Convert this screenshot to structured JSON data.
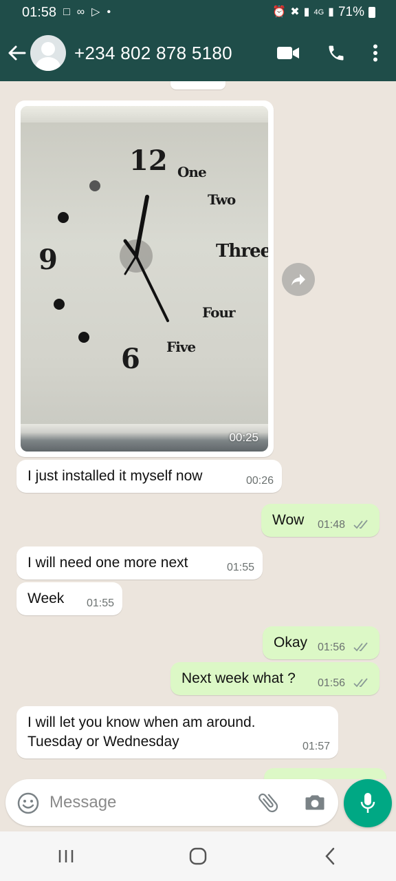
{
  "status_bar": {
    "time": "01:58",
    "battery": "71%",
    "network": "4G",
    "bar_color": "#1f4d49"
  },
  "header": {
    "contact": "+234 802 878 5180",
    "icons": [
      "back-arrow-icon",
      "avatar",
      "video-call-icon",
      "phone-icon",
      "more-vert-icon"
    ]
  },
  "media_message": {
    "duration": "00:25",
    "clock_labels": {
      "twelve": "12",
      "nine": "9",
      "six": "6",
      "one": "One",
      "two": "Two",
      "three": "Three",
      "four": "Four",
      "five": "Five"
    }
  },
  "messages": [
    {
      "direction": "in",
      "text": "I just installed it myself now",
      "time": "00:26"
    },
    {
      "direction": "out",
      "text": "Wow",
      "time": "01:48",
      "status": "read"
    },
    {
      "direction": "in",
      "text": "I will need one more next",
      "time": "01:55"
    },
    {
      "direction": "in",
      "text": "Week",
      "time": "01:55"
    },
    {
      "direction": "out",
      "text": "Okay",
      "time": "01:56",
      "status": "read"
    },
    {
      "direction": "out",
      "text": "Next week what ?",
      "time": "01:56",
      "status": "read"
    },
    {
      "direction": "in",
      "text_lines": [
        "I will let you know when am around.",
        "Tuesday or Wednesday"
      ],
      "time": "01:57"
    }
  ],
  "composer": {
    "placeholder": "Message",
    "accent": "#00a884"
  }
}
